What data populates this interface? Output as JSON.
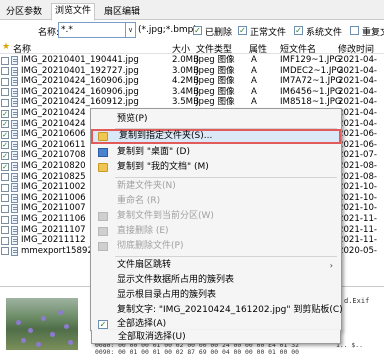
{
  "tabs": [
    "分区参数",
    "浏览文件",
    "扇区编辑"
  ],
  "filter": {
    "name_label": "名称:",
    "name_value": "*.*",
    "ext_text": "(*.jpg;*.bmp)",
    "checkboxes": [
      {
        "label": "已删除",
        "checked": true
      },
      {
        "label": "正常文件",
        "checked": true
      },
      {
        "label": "系统文件",
        "checked": true
      },
      {
        "label": "重复文件",
        "checked": false
      }
    ]
  },
  "columns": [
    "名称",
    "大小",
    "文件类型",
    "属性",
    "短文件名",
    "修改时间"
  ],
  "rows": [
    {
      "name": "IMG_20210401_190441.jpg",
      "size": "2.0MB",
      "type": "Jpeg 图像",
      "attr": "A",
      "short": "IMF129~1.JPG",
      "time": "2021-04-",
      "checked": false
    },
    {
      "name": "IMG_20210401_192727.jpg",
      "size": "3.0MB",
      "type": "Jpeg 图像",
      "attr": "A",
      "short": "IMDEC2~1.JPG",
      "time": "2021-04-",
      "checked": false
    },
    {
      "name": "IMG_20210424_160906.jpg",
      "size": "4.2MB",
      "type": "Jpeg 图像",
      "attr": "A",
      "short": "IM7A72~1.JPG",
      "time": "2021-04-",
      "checked": false
    },
    {
      "name": "IMG_20210424_160906.jpg",
      "size": "3.4MB",
      "type": "Jpeg 图像",
      "attr": "A",
      "short": "IM6456~1.JPG",
      "time": "2021-04-",
      "checked": false
    },
    {
      "name": "IMG_20210424_160912.jpg",
      "size": "3.5MB",
      "type": "Jpeg 图像",
      "attr": "A",
      "short": "IM8518~1.JPG",
      "time": "2021-04-",
      "checked": false
    },
    {
      "name": "IMG_20210424",
      "size": "",
      "type": "",
      "attr": "",
      "short": "",
      "time": "2021-04-",
      "checked": true
    },
    {
      "name": "IMG_20210424",
      "size": "",
      "type": "",
      "attr": "",
      "short": "",
      "time": "2021-04-",
      "checked": true
    },
    {
      "name": "IMG_20210606",
      "size": "",
      "type": "",
      "attr": "",
      "short": "",
      "time": "2021-06-",
      "checked": true
    },
    {
      "name": "IMG_20210611",
      "size": "",
      "type": "",
      "attr": "",
      "short": "",
      "time": "2021-06-",
      "checked": true
    },
    {
      "name": "IMG_20210708",
      "size": "",
      "type": "",
      "attr": "",
      "short": "",
      "time": "2021-07-",
      "checked": true
    },
    {
      "name": "IMG_20210820",
      "size": "",
      "type": "",
      "attr": "",
      "short": "",
      "time": "2021-08-",
      "checked": true
    },
    {
      "name": "IMG_20210825",
      "size": "",
      "type": "",
      "attr": "",
      "short": "",
      "time": "2021-08-",
      "checked": false
    },
    {
      "name": "IMG_20211002",
      "size": "",
      "type": "",
      "attr": "",
      "short": "",
      "time": "2021-10-",
      "checked": false
    },
    {
      "name": "IMG_20211006",
      "size": "",
      "type": "",
      "attr": "",
      "short": "",
      "time": "2021-10-",
      "checked": false
    },
    {
      "name": "IMG_20211007",
      "size": "",
      "type": "",
      "attr": "",
      "short": "",
      "time": "2021-10-",
      "checked": false
    },
    {
      "name": "IMG_20211106",
      "size": "",
      "type": "",
      "attr": "",
      "short": "",
      "time": "2021-11-",
      "checked": false
    },
    {
      "name": "IMG_20211107",
      "size": "",
      "type": "",
      "attr": "",
      "short": "",
      "time": "2021-11-",
      "checked": false
    },
    {
      "name": "IMG_20211112",
      "size": "",
      "type": "",
      "attr": "",
      "short": "",
      "time": "2021-11-",
      "checked": false
    },
    {
      "name": "mmexport15892",
      "size": "",
      "type": "",
      "attr": "",
      "short": "",
      "time": "2020-05-",
      "checked": false
    }
  ],
  "menu": {
    "preview": "预览(P)",
    "copy_to": "复制到指定文件夹(S)...",
    "copy_desktop": "复制到 \"桌面\" (D)",
    "copy_docs": "复制到 \"我的文档\" (M)",
    "new_folder": "新建文件夹(N)",
    "rename": "重命名 (R)",
    "copy_to_current": "复制文件到当前分区(W)",
    "delete_direct": "直接删除 (E)",
    "delete_perm": "彻底删除文件(P)",
    "sector_jump": "文件扇区跳转",
    "show_clusters": "显示文件数据所占用的簇列表",
    "show_root_clusters": "显示根目录占用的簇列表",
    "copy_text": "复制文字: \"IMG_20210424_161202.jpg\" 到剪贴板(C)",
    "select_all": "全部选择(A)",
    "deselect_all": "全部取消选择(U)"
  },
  "hex": {
    "line1": "0080: 00 00 00 01 00 02 00 00 00 24 00 00 00 E4 01 32",
    "line2": "0090: 00 01 00 01 00 02 87 69 00 04 00 00 00 01 00 00",
    "right_top": "d.Exif",
    "right_b1": "1..  $..",
    "right_b2": "......"
  }
}
